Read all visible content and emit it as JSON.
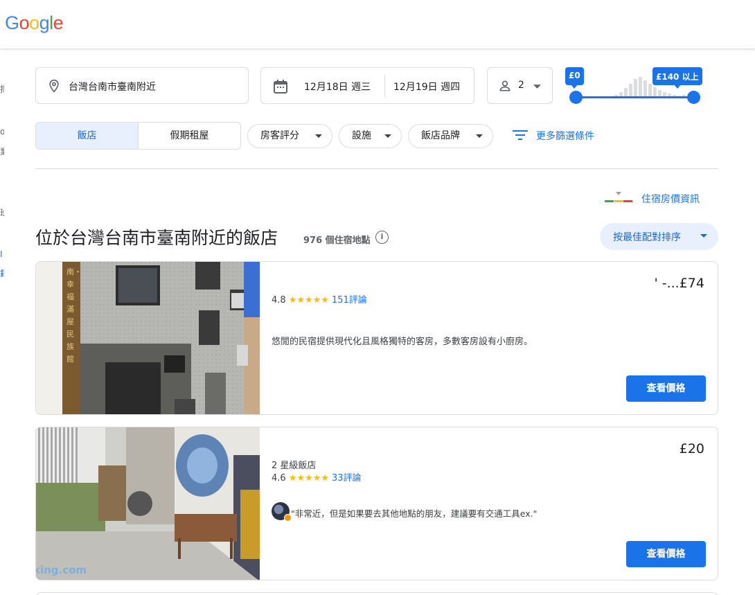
{
  "header": {
    "logo": "Google"
  },
  "search": {
    "location": "台灣台南市臺南附近",
    "checkin": "12月18日 週三",
    "checkout": "12月19日 週四",
    "guests": "2"
  },
  "price_filter": {
    "min_label": "£0",
    "max_label": "£140 以上"
  },
  "filters": {
    "tab_hotels": "飯店",
    "tab_rentals": "假期租屋",
    "chip_rating": "房客評分",
    "chip_amenities": "設施",
    "chip_brand": "飯店品牌",
    "more_filters": "更多篩選條件"
  },
  "price_info_link": "住宿房價資訊",
  "results": {
    "title": "位於台灣台南市臺南附近的飯店",
    "count": "976 個住宿地點",
    "sort_label": "按最佳配對排序"
  },
  "hotels": [
    {
      "price": "' -...£74",
      "rating": "4.8",
      "stars": "★★★★★",
      "reviews": "151評論",
      "description": "悠閒的民宿提供現代化且風格獨特的客房，多數客房設有小廚房。",
      "button": "查看價格",
      "sign_text": "南・幸福滿屋民族館"
    },
    {
      "price": "£20",
      "class": "2 星級飯店",
      "rating": "4.6",
      "stars": "★★★★★",
      "reviews": "33評論",
      "quote": "\"非常近，但是如果要去其他地點的朋友，建議要有交通工具ex.\"",
      "button": "查看價格",
      "watermark": "king.com"
    }
  ],
  "edge_text": [
    "擇",
    "o",
    "業",
    "班",
    "I",
    "籍"
  ],
  "colors": {
    "accent": "#1a73e8",
    "chip_bg": "#e8f0fe",
    "star": "#fbbc04"
  }
}
